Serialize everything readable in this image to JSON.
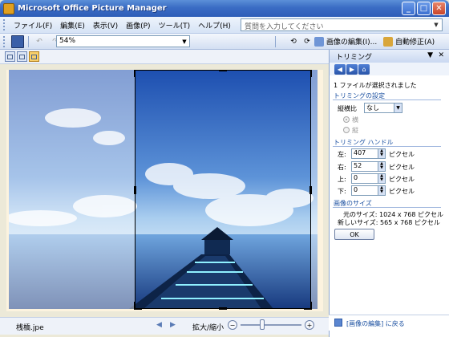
{
  "window": {
    "title": "Microsoft Office Picture Manager"
  },
  "menu": {
    "items": [
      "ファイル(F)",
      "編集(E)",
      "表示(V)",
      "画像(P)",
      "ツール(T)",
      "ヘルプ(H)"
    ],
    "help_placeholder": "質問を入力してください"
  },
  "toolbar": {
    "zoom_value": "54%",
    "edit_picture_label": "画像の編集(I)...",
    "auto_correct_label": "自動修正(A)"
  },
  "statusbar": {
    "filename": "桟橋.jpe",
    "zoom_label": "拡大/縮小",
    "zoom_slider_fraction": 0.35
  },
  "pane": {
    "title": "トリミング",
    "selection_info": "1 ファイルが選択されました",
    "crop_settings_heading": "トリミングの設定",
    "aspect_ratio_label": "縦横比",
    "aspect_ratio_value": "なし",
    "landscape_label": "横",
    "portrait_label": "縦",
    "handles_heading": "トリミング ハンドル",
    "handles": [
      {
        "label": "左:",
        "value": "407",
        "unit": "ピクセル"
      },
      {
        "label": "右:",
        "value": "52",
        "unit": "ピクセル"
      },
      {
        "label": "上:",
        "value": "0",
        "unit": "ピクセル"
      },
      {
        "label": "下:",
        "value": "0",
        "unit": "ピクセル"
      }
    ],
    "size_heading": "画像のサイズ",
    "original_size": "元のサイズ: 1024 x 768 ピクセル",
    "new_size": "新しいサイズ: 565 x 768 ピクセル",
    "ok_label": "OK",
    "footer_link": "[画像の編集] に戻る"
  }
}
